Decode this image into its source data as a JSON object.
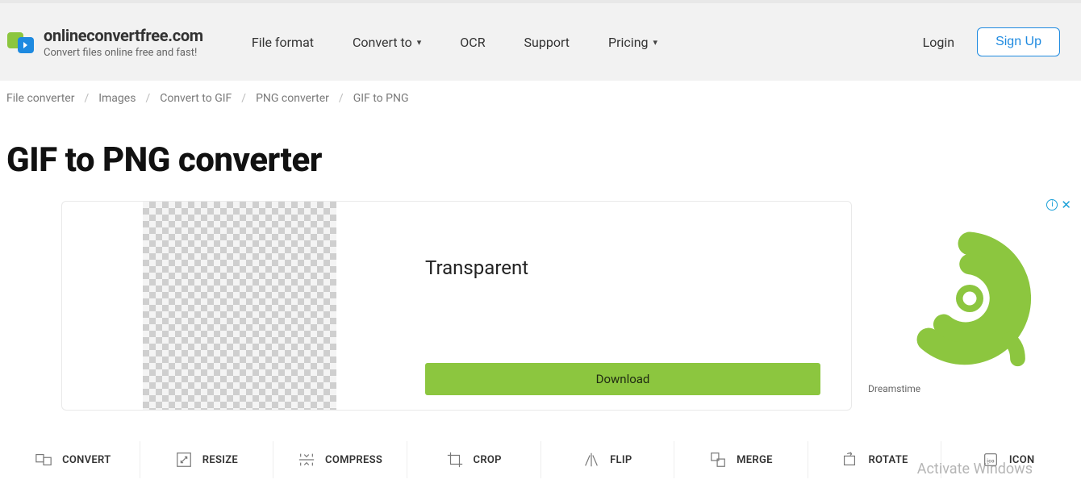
{
  "brand": {
    "title": "onlineconvertfree.com",
    "subtitle": "Convert files online free and fast!"
  },
  "nav": {
    "file_format": "File format",
    "convert_to": "Convert to",
    "ocr": "OCR",
    "support": "Support",
    "pricing": "Pricing"
  },
  "auth": {
    "login": "Login",
    "signup": "Sign Up"
  },
  "breadcrumb": {
    "items": [
      "File converter",
      "Images",
      "Convert to GIF",
      "PNG converter",
      "GIF to PNG"
    ]
  },
  "page": {
    "title": "GIF to PNG converter"
  },
  "ad": {
    "title": "Transparent",
    "button": "Download",
    "side_label": "Dreamstime",
    "info_char": "i",
    "close_char": "✕"
  },
  "tools": {
    "items": [
      {
        "label": "CONVERT",
        "icon": "convert-icon"
      },
      {
        "label": "RESIZE",
        "icon": "resize-icon"
      },
      {
        "label": "COMPRESS",
        "icon": "compress-icon"
      },
      {
        "label": "CROP",
        "icon": "crop-icon"
      },
      {
        "label": "FLIP",
        "icon": "flip-icon"
      },
      {
        "label": "MERGE",
        "icon": "merge-icon"
      },
      {
        "label": "ROTATE",
        "icon": "rotate-icon"
      },
      {
        "label": "ICON",
        "icon": "icon-icon"
      }
    ]
  },
  "watermark": "Activate Windows"
}
